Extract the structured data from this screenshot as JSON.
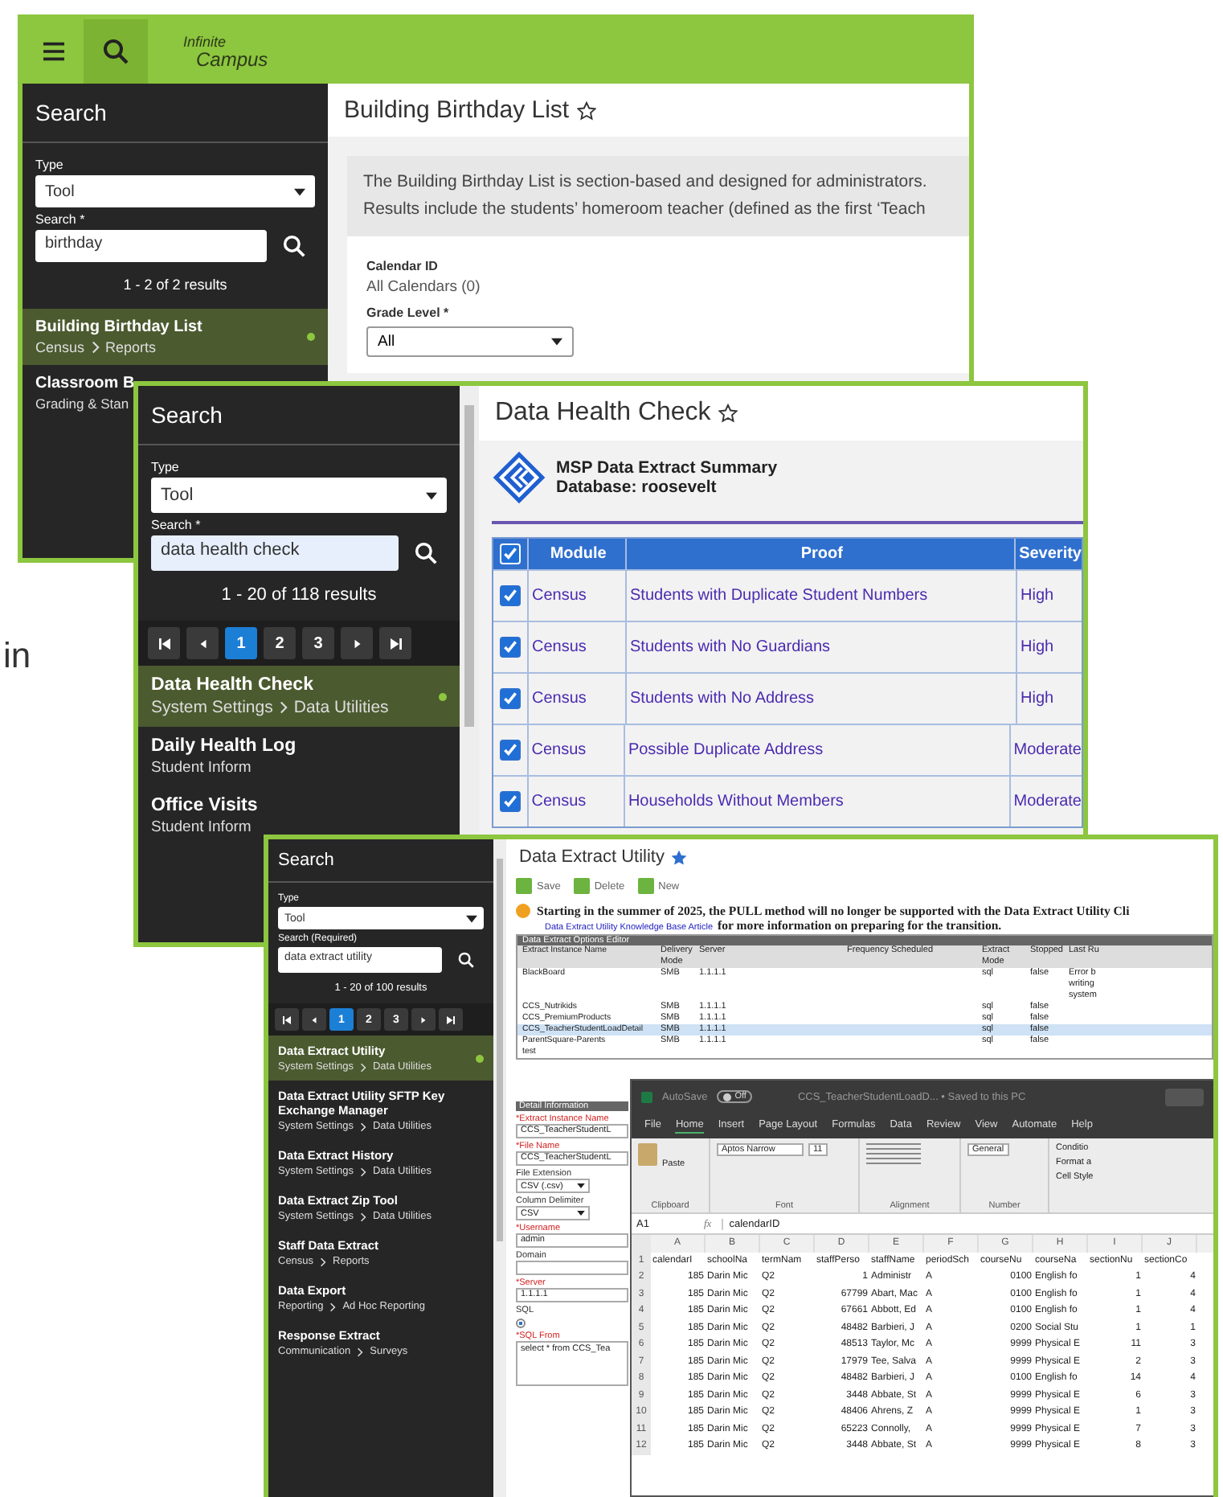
{
  "side_text": "in",
  "screens": [
    {
      "kind": "report_form",
      "header": {
        "logo_top": "Infinite",
        "logo_bottom": "Campus"
      },
      "sidebar": {
        "title": "Search",
        "type_label": "Type",
        "type_value": "Tool",
        "search_label": "Search *",
        "search_value": "birthday",
        "results": "1 - 2 of 2 results",
        "items": [
          {
            "title": "Building Birthday List",
            "path": [
              "Census",
              "Reports"
            ],
            "selected": true
          },
          {
            "title": "Classroom B",
            "path": [
              "Grading & Stan"
            ],
            "selected": false
          }
        ]
      },
      "title": "Building Birthday List",
      "favorite": false,
      "description": [
        "The Building Birthday List is section-based and designed for administrators.",
        "Results include the students’ homeroom teacher (defined as the first ‘Teach"
      ],
      "fields": [
        {
          "label": "Calendar ID",
          "kind": "text",
          "value": "All Calendars (0)"
        },
        {
          "label": "Grade Level *",
          "kind": "select",
          "value": "All"
        }
      ]
    },
    {
      "kind": "summary_table",
      "sidebar": {
        "title": "Search",
        "type_label": "Type",
        "type_value": "Tool",
        "search_label": "Search *",
        "search_value": "data health check",
        "results": "1 - 20 of 118 results",
        "pages": [
          {
            "label": "1",
            "selected": true
          },
          {
            "label": "2",
            "selected": false
          },
          {
            "label": "3",
            "selected": false
          }
        ],
        "items": [
          {
            "title": "Data Health Check",
            "path": [
              "System Settings",
              "Data Utilities"
            ],
            "selected": true
          },
          {
            "title": "Daily Health Log",
            "path": [
              "Student Inform"
            ],
            "selected": false
          },
          {
            "title": "Office Visits",
            "path": [
              "Student Inform"
            ],
            "selected": false
          }
        ]
      },
      "title": "Data Health Check",
      "favorite": false,
      "summary_title": "MSP Data Extract Summary",
      "database": "Database: roosevelt",
      "all_checked": true,
      "columns": [
        "Module",
        "Proof",
        "Severity"
      ],
      "rows": [
        {
          "checked": true,
          "module": "Census",
          "proof": "Students with Duplicate Student Numbers",
          "severity": "High"
        },
        {
          "checked": true,
          "module": "Census",
          "proof": "Students with No Guardians",
          "severity": "High"
        },
        {
          "checked": true,
          "module": "Census",
          "proof": "Students with No Address",
          "severity": "High"
        },
        {
          "checked": true,
          "module": "Census",
          "proof": "Possible Duplicate Address",
          "severity": "Moderate"
        },
        {
          "checked": true,
          "module": "Census",
          "proof": "Households Without Members",
          "severity": "Moderate"
        }
      ]
    },
    {
      "kind": "extract_editor",
      "sidebar": {
        "title": "Search",
        "type_label": "Type",
        "type_value": "Tool",
        "search_label": "Search (Required)",
        "search_value": "data extract utility",
        "results": "1 - 20 of 100 results",
        "pages": [
          {
            "label": "1",
            "selected": true
          },
          {
            "label": "2",
            "selected": false
          },
          {
            "label": "3",
            "selected": false
          }
        ],
        "items": [
          {
            "title": "Data Extract Utility",
            "path": [
              "System Settings",
              "Data Utilities"
            ],
            "selected": true
          },
          {
            "title": "Data Extract Utility SFTP Key Exchange Manager",
            "path": [
              "System Settings",
              "Data Utilities"
            ],
            "selected": false
          },
          {
            "title": "Data Extract History",
            "path": [
              "System Settings",
              "Data Utilities"
            ],
            "selected": false
          },
          {
            "title": "Data Extract Zip Tool",
            "path": [
              "System Settings",
              "Data Utilities"
            ],
            "selected": false
          },
          {
            "title": "Staff Data Extract",
            "path": [
              "Census",
              "Reports"
            ],
            "selected": false
          },
          {
            "title": "Data Export",
            "path": [
              "Reporting",
              "Ad Hoc Reporting"
            ],
            "selected": false
          },
          {
            "title": "Response Extract",
            "path": [
              "Communication",
              "Surveys"
            ],
            "selected": false
          }
        ]
      },
      "title": "Data Extract Utility",
      "favorite": true,
      "actions": [
        "Save",
        "Delete",
        "New"
      ],
      "notice": "Starting in the summer of 2025, the PULL method will no longer be supported with the Data Extract Utility Cli",
      "notice_link": "Data Extract Utility Knowledge Base Article",
      "notice_tail": "for more information on preparing for the transition.",
      "grid_title": "Data Extract Options Editor",
      "grid_columns": [
        "Extract Instance Name",
        "Delivery Mode",
        "Server",
        "Frequency Scheduled",
        "Extract Mode",
        "Stopped",
        "Last Ru"
      ],
      "grid_rows": [
        {
          "name": "BlackBoard",
          "mode": "SMB",
          "server": "1.1.1.1",
          "extract_mode": "sql",
          "stopped": "false",
          "last_run": [
            "Error b",
            "writing",
            "system"
          ],
          "selected": false
        },
        {
          "name": "CCS_Nutrikids",
          "mode": "SMB",
          "server": "1.1.1.1",
          "extract_mode": "sql",
          "stopped": "false",
          "selected": false
        },
        {
          "name": "CCS_PremiumProducts",
          "mode": "SMB",
          "server": "1.1.1.1",
          "extract_mode": "sql",
          "stopped": "false",
          "selected": false
        },
        {
          "name": "CCS_TeacherStudentLoadDetail",
          "mode": "SMB",
          "server": "1.1.1.1",
          "extract_mode": "sql",
          "stopped": "false",
          "selected": true
        },
        {
          "name": "ParentSquare-Parents",
          "mode": "SMB",
          "server": "1.1.1.1",
          "extract_mode": "sql",
          "stopped": "false",
          "selected": false
        },
        {
          "name": "test",
          "selected": false
        }
      ],
      "detail_title": "Detail Information",
      "detail_fields": [
        {
          "label": "*Extract Instance Name",
          "required": true,
          "kind": "text",
          "value": "CCS_TeacherStudentL"
        },
        {
          "label": "*File Name",
          "required": true,
          "kind": "text",
          "value": "CCS_TeacherStudentL"
        },
        {
          "label": "File Extension",
          "required": false,
          "kind": "select",
          "value": "CSV (.csv)"
        },
        {
          "label": "Column Delimiter",
          "required": false,
          "kind": "select",
          "value": "CSV"
        },
        {
          "label": "*Username",
          "required": true,
          "kind": "text",
          "value": "admin"
        },
        {
          "label": "Domain",
          "required": false,
          "kind": "text"
        },
        {
          "label": "*Server",
          "required": true,
          "kind": "text",
          "value": "1.1.1.1"
        },
        {
          "label": "SQL",
          "required": false,
          "kind": "radio",
          "checked": true
        },
        {
          "label": "*SQL From",
          "required": true,
          "kind": "textarea",
          "value": "select * from CCS_Tea"
        }
      ],
      "spreadsheet": {
        "autosave": "AutoSave",
        "autosave_on": false,
        "autosave_state": "Off",
        "file": "CCS_TeacherStudentLoadD... • Saved to this PC",
        "menu": [
          {
            "label": "File",
            "selected": false
          },
          {
            "label": "Home",
            "selected": true
          },
          {
            "label": "Insert",
            "selected": false
          },
          {
            "label": "Page Layout",
            "selected": false
          },
          {
            "label": "Formulas",
            "selected": false
          },
          {
            "label": "Data",
            "selected": false
          },
          {
            "label": "Review",
            "selected": false
          },
          {
            "label": "View",
            "selected": false
          },
          {
            "label": "Automate",
            "selected": false
          },
          {
            "label": "Help",
            "selected": false
          }
        ],
        "paste": "Paste",
        "font": "Aptos Narrow",
        "font_size": "11",
        "number_format": "General",
        "styles": [
          "Conditio",
          "Format a",
          "Cell Style"
        ],
        "groups": [
          "Clipboard",
          "Font",
          "Alignment",
          "Number"
        ],
        "cell_ref": "A1",
        "function_symbol": "fx",
        "formula": "calendarID",
        "columns": [
          "A",
          "B",
          "C",
          "D",
          "E",
          "F",
          "G",
          "H",
          "I",
          "J"
        ],
        "rows": [
          {
            "n": "1",
            "cells": [
              "calendarI",
              "schoolNa",
              "termNam",
              "staffPerso",
              "staffName",
              "periodSch",
              "courseNu",
              "courseNa",
              "sectionNu",
              "sectionCo"
            ]
          },
          {
            "n": "2",
            "cells": [
              "185",
              "Darin Mic",
              "Q2",
              "1",
              "Administr",
              "A",
              "0100",
              "English fo",
              "1",
              "4"
            ]
          },
          {
            "n": "3",
            "cells": [
              "185",
              "Darin Mic",
              "Q2",
              "67799",
              "Abart, Mac",
              "A",
              "0100",
              "English fo",
              "1",
              "4"
            ]
          },
          {
            "n": "4",
            "cells": [
              "185",
              "Darin Mic",
              "Q2",
              "67661",
              "Abbott, Ed",
              "A",
              "0100",
              "English fo",
              "1",
              "4"
            ]
          },
          {
            "n": "5",
            "cells": [
              "185",
              "Darin Mic",
              "Q2",
              "48482",
              "Barbieri, J",
              "A",
              "0200",
              "Social Stu",
              "1",
              "1"
            ]
          },
          {
            "n": "6",
            "cells": [
              "185",
              "Darin Mic",
              "Q2",
              "48513",
              "Taylor, Mc",
              "A",
              "9999",
              "Physical E",
              "11",
              "3"
            ]
          },
          {
            "n": "7",
            "cells": [
              "185",
              "Darin Mic",
              "Q2",
              "17979",
              "Tee, Salva",
              "A",
              "9999",
              "Physical E",
              "2",
              "3"
            ]
          },
          {
            "n": "8",
            "cells": [
              "185",
              "Darin Mic",
              "Q2",
              "48482",
              "Barbieri, J",
              "A",
              "0100",
              "English fo",
              "14",
              "4"
            ]
          },
          {
            "n": "9",
            "cells": [
              "185",
              "Darin Mic",
              "Q2",
              "3448",
              "Abbate, St",
              "A",
              "9999",
              "Physical E",
              "6",
              "3"
            ]
          },
          {
            "n": "10",
            "cells": [
              "185",
              "Darin Mic",
              "Q2",
              "48406",
              "Ahrens, Z",
              "A",
              "9999",
              "Physical E",
              "1",
              "3"
            ]
          },
          {
            "n": "11",
            "cells": [
              "185",
              "Darin Mic",
              "Q2",
              "65223",
              "Connolly,",
              "A",
              "9999",
              "Physical E",
              "7",
              "3"
            ]
          },
          {
            "n": "12",
            "cells": [
              "185",
              "Darin Mic",
              "Q2",
              "3448",
              "Abbate, St",
              "A",
              "9999",
              "Physical E",
              "8",
              "3"
            ]
          }
        ]
      }
    }
  ]
}
